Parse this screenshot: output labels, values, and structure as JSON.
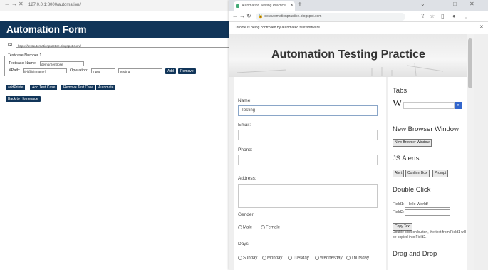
{
  "background_window": {
    "url": "127.0.0.1:8000/automation/",
    "form_title": "Automation Form",
    "url_label": "URL",
    "url_value": "https://testautomationpractice.blogspot.com/",
    "testcase_legend": "Testcase Number 1",
    "testcase_name_label": "Testcase Name:",
    "testcase_name_value": "demo/Sentrose",
    "xpath_label": "XPath:",
    "xpath_value": "//*[@id='name']",
    "operation_label": "Operation:",
    "operation_value": "Input",
    "operation_text": "Testing",
    "add_button": "Add",
    "remove_button": "Remove",
    "buttons": [
      "addPrinte",
      "Add Test Case",
      "Remove Test Case",
      "Automate"
    ],
    "back_button": "Back to Homepage"
  },
  "browser": {
    "tab_title": "Automation Testing Practice",
    "address": "testautomationpractice.blogspot.com",
    "infobar": "Chrome is being controlled by automated test software.",
    "page": {
      "title": "Automation Testing Practice",
      "form": {
        "name_label": "Name:",
        "name_value": "Testing",
        "email_label": "Email:",
        "phone_label": "Phone:",
        "address_label": "Address:",
        "gender_label": "Gender:",
        "genders": [
          "Male",
          "Female"
        ],
        "days_label": "Days:",
        "days": [
          "Sunday",
          "Monday",
          "Tuesday",
          "Wednesday",
          "Thursday"
        ]
      },
      "sidebar": {
        "tabs_heading": "Tabs",
        "wiki_letter": "W",
        "new_window_heading": "New Browser Window",
        "new_window_button": "New Browser Window",
        "js_alerts_heading": "JS Alerts",
        "alert_buttons": [
          "Alert",
          "Confirm Box",
          "Prompt"
        ],
        "double_click_heading": "Double Click",
        "field1_label": "Field1:",
        "field1_value": "Hello World!",
        "field2_label": "Field2:",
        "copy_button": "Copy Text",
        "double_click_note": "Double click on button, the text from Field1 will be copied into Field2.",
        "drag_drop_heading": "Drag and Drop"
      }
    }
  }
}
